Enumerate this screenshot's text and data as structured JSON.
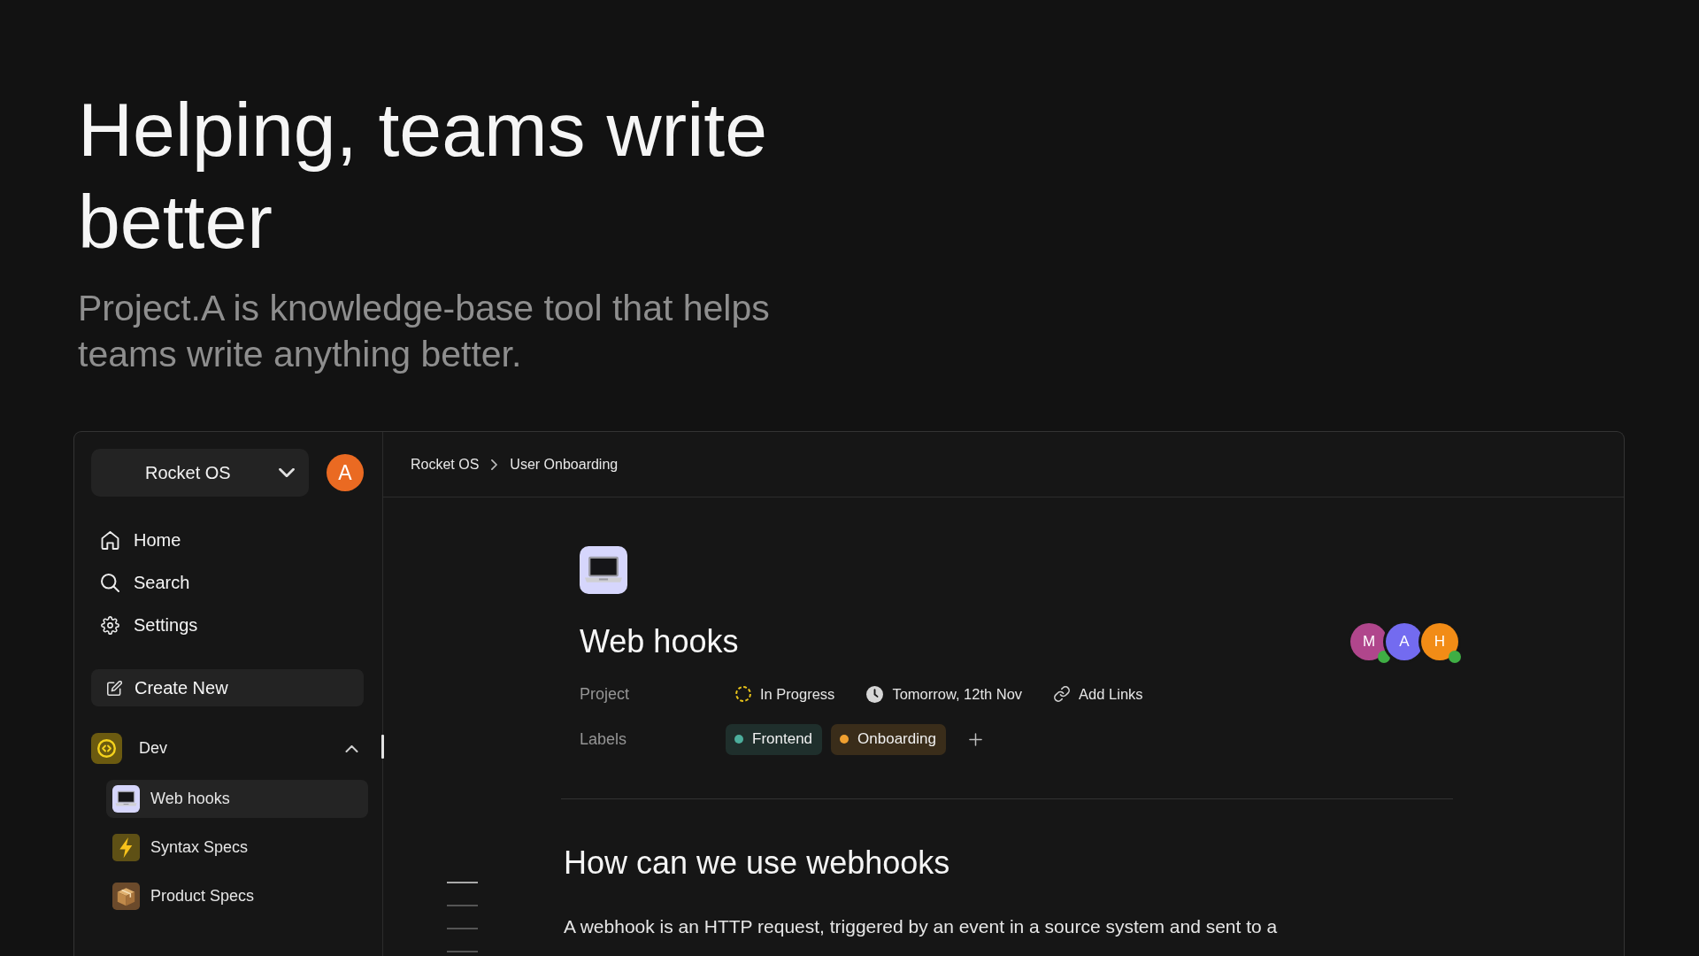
{
  "hero": {
    "title": "Helping, teams write better",
    "subtitle": "Project.A is knowledge-base tool that helps teams write anything better."
  },
  "sidebar": {
    "workspace": "Rocket OS",
    "user_initial": "A",
    "nav": [
      {
        "kind": "home",
        "label": "Home"
      },
      {
        "kind": "search",
        "label": "Search"
      },
      {
        "kind": "settings",
        "label": "Settings"
      }
    ],
    "create_button": "Create New",
    "groups": [
      {
        "kind": "code",
        "name": "Dev",
        "expanded": true,
        "items": [
          {
            "kind": "laptop",
            "label": "Web hooks",
            "selected": true
          },
          {
            "kind": "bolt",
            "label": "Syntax Specs",
            "selected": false
          },
          {
            "kind": "package",
            "label": "Product Specs",
            "selected": false
          }
        ]
      }
    ]
  },
  "breadcrumb": [
    "Rocket OS",
    "User Onboarding"
  ],
  "document": {
    "kind": "laptop",
    "title": "Web hooks",
    "collaborators": [
      {
        "initial": "M",
        "color": "#b0468c",
        "online": true
      },
      {
        "initial": "A",
        "color": "#736bf0",
        "online": false
      },
      {
        "initial": "H",
        "color": "#f28c16",
        "online": true
      }
    ],
    "properties": [
      {
        "label": "Project",
        "kind": "actions",
        "items": [
          {
            "kind": "status",
            "text": "In Progress"
          },
          {
            "kind": "due_date",
            "text": "Tomorrow, 12th Nov"
          },
          {
            "kind": "link",
            "text": "Add Links"
          }
        ]
      },
      {
        "label": "Labels",
        "kind": "tags",
        "items": [
          {
            "text": "Frontend",
            "color": "#4cae9c"
          },
          {
            "text": "Onboarding",
            "color": "#f0a030"
          }
        ]
      }
    ],
    "outline": [
      {
        "selected": true
      },
      {
        "selected": false
      },
      {
        "selected": false
      },
      {
        "selected": false
      }
    ],
    "heading": "How can we use webhooks",
    "paragraph": "A webhook is an HTTP request, triggered by an event in a source system and sent to a"
  }
}
